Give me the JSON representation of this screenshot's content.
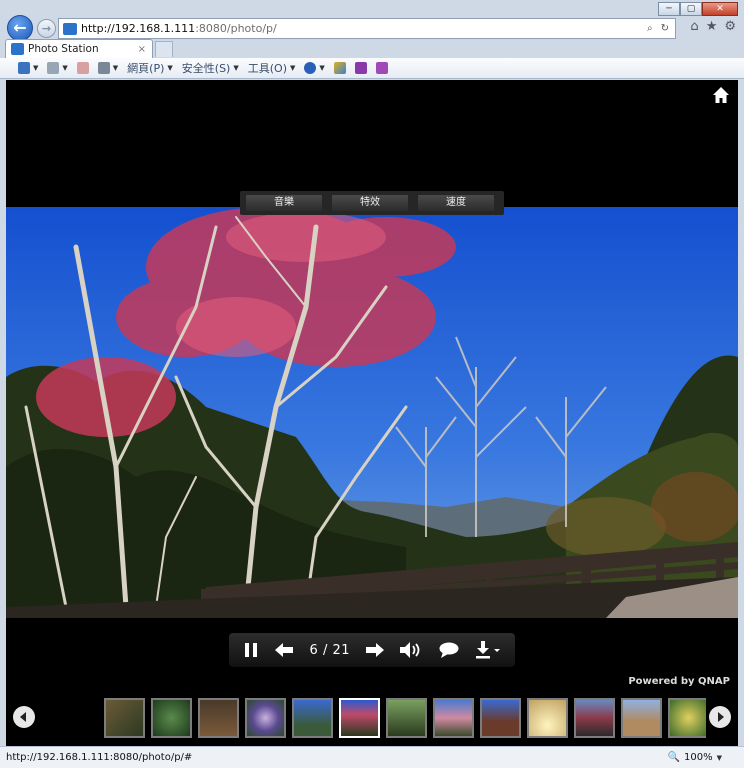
{
  "browser": {
    "url_host": "http://192.168.1.111",
    "url_rest": ":8080/photo/p/",
    "tab_title": "Photo Station",
    "tab_close": "×",
    "win_min": "─",
    "win_max": "▢",
    "win_close": "✕",
    "search_glyph": "⌕",
    "refresh_glyph": "↻",
    "back_glyph": "←",
    "fwd_glyph": "→",
    "background_tabs": [
      "",
      "",
      ""
    ],
    "toolbar": {
      "page_menu": "網頁(P)",
      "safety_menu": "安全性(S)",
      "tools_menu": "工具(O)"
    },
    "status_url": "http://192.168.1.111:8080/photo/p/#",
    "zoom": "100%"
  },
  "app": {
    "menu": [
      "音樂",
      "特效",
      "速度"
    ],
    "counter": "6 / 21",
    "current_index": 6,
    "total": 21,
    "powered_by": "Powered by QNAP"
  },
  "colors": {
    "sky": "#1e5fd9",
    "blossom": "#c43a5a",
    "accent": "#2a73c9"
  },
  "icons": {
    "home": "home-icon",
    "pause": "pause-icon",
    "prev": "arrow-left-icon",
    "next": "arrow-right-icon",
    "volume": "volume-icon",
    "comment": "speech-bubble-icon",
    "download": "download-icon"
  }
}
